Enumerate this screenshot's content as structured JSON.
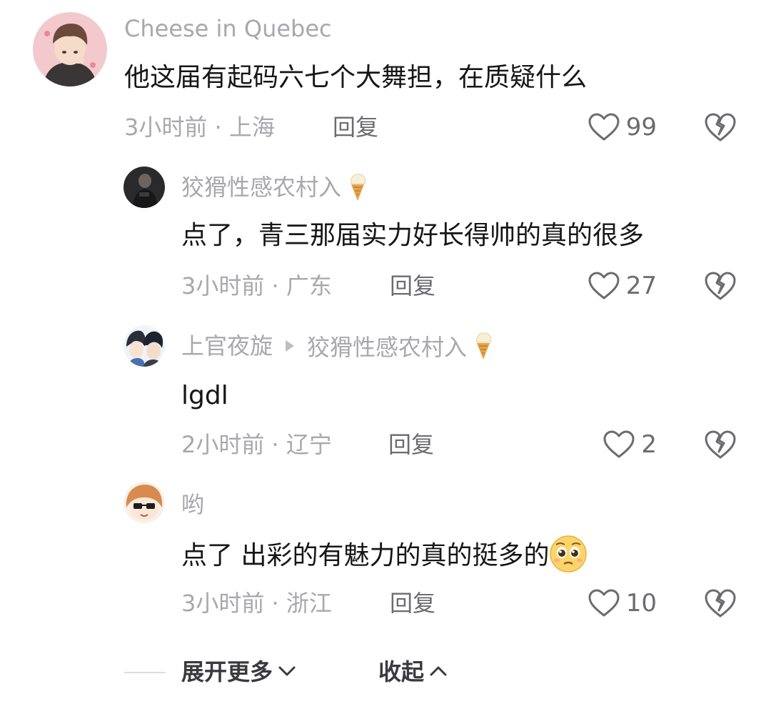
{
  "comments": [
    {
      "username": "Cheese in Quebec",
      "text": "他这届有起码六七个大舞担，在质疑什么",
      "time_location": "3小时前 · 上海",
      "reply_label": "回复",
      "likes": "99",
      "avatar_icon": "boy-cartoon-avatar"
    },
    {
      "username": "狡猾性感农村入",
      "badge_icon": "ice-cream-icon",
      "text": "点了，青三那届实力好长得帅的真的很多",
      "time_location": "3小时前 · 广东",
      "reply_label": "回复",
      "likes": "27",
      "avatar_icon": "dark-photo-avatar"
    },
    {
      "username": "上官夜旋",
      "reply_to": "狡猾性感农村入",
      "badge_icon": "ice-cream-icon",
      "text": "lgdl",
      "time_location": "2小时前 · 辽宁",
      "reply_label": "回复",
      "likes": "2",
      "avatar_icon": "anime-couple-avatar"
    },
    {
      "username": "哟",
      "text": "点了 出彩的有魅力的真的挺多的",
      "emoji_icon": "pleading-face-emoji",
      "time_location": "3小时前 · 浙江",
      "reply_label": "回复",
      "likes": "10",
      "avatar_icon": "anime-girl-sunglasses-avatar"
    }
  ],
  "footer": {
    "expand_label": "展开更多",
    "collapse_label": "收起"
  },
  "colors": {
    "username": "#a8a8ad",
    "text": "#161616",
    "meta": "#a8a8ad",
    "icon": "#6b6b70"
  }
}
